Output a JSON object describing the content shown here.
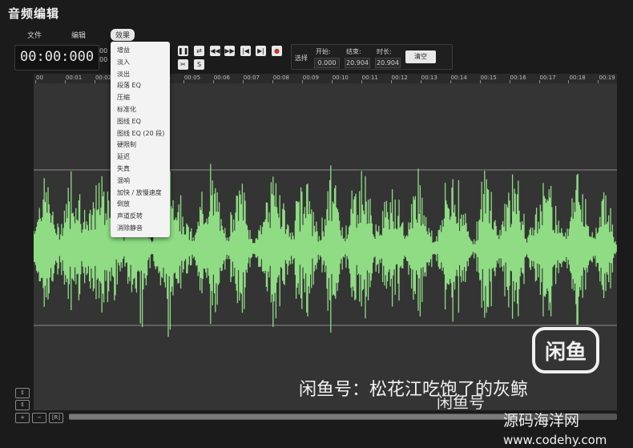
{
  "app": {
    "title": "音频编辑"
  },
  "menubar": {
    "file": "文件",
    "edit": "编辑",
    "effects": "效果"
  },
  "toolbar": {
    "time": "00:00:000",
    "time_aside": [
      "00",
      "00"
    ],
    "buttons": [
      {
        "name": "pause-button",
        "icon": "pause-icon",
        "glyph": "❚❚"
      },
      {
        "name": "loop-button",
        "icon": "loop-icon",
        "glyph": "⇄"
      },
      {
        "name": "rewind-button",
        "icon": "rewind-icon",
        "glyph": "◀◀"
      },
      {
        "name": "fast-forward-button",
        "icon": "fast-forward-icon",
        "glyph": "▶▶"
      },
      {
        "name": "skip-start-button",
        "icon": "skip-start-icon",
        "glyph": "|◀"
      },
      {
        "name": "skip-end-button",
        "icon": "skip-end-icon",
        "glyph": "▶|"
      },
      {
        "name": "record-button",
        "icon": "record-icon",
        "glyph": "●"
      },
      {
        "name": "cut-button",
        "icon": "scissors-icon",
        "glyph": "✂"
      },
      {
        "name": "split-button",
        "icon": "split-icon",
        "glyph": "S"
      }
    ]
  },
  "selection": {
    "label": "选择",
    "start_label": "开始:",
    "start_value": "0.000",
    "end_label": "结束:",
    "end_value": "20.904",
    "duration_label": "时长:",
    "duration_value": "20.904",
    "clear_label": "清空"
  },
  "ruler": {
    "ticks": [
      "00",
      "00:01",
      "00:02",
      "00:03",
      "00:04",
      "00:05",
      "00:06",
      "00:07",
      "00:08",
      "00:09",
      "00:10",
      "00:11",
      "00:12",
      "00:13",
      "00:14",
      "00:15",
      "00:16",
      "00:17",
      "00:18",
      "00:19"
    ]
  },
  "effects_menu": {
    "items": [
      "增益",
      "淡入",
      "淡出",
      "段落 EQ",
      "压缩",
      "标准化",
      "图线 EQ",
      "图线 EQ (20 段)",
      "硬限制",
      "延迟",
      "失真",
      "混响",
      "加快 / 放慢速度",
      "倒放",
      "声道反转",
      "消除静音"
    ]
  },
  "side_controls": [
    "↕",
    "↕",
    "+",
    "−",
    "[R]"
  ],
  "colors": {
    "waveform": "#8fdc84",
    "waveform_bg": "#343434",
    "page_bg": "#1b1b1b"
  },
  "watermark": {
    "logo_text": "闲鱼",
    "line1": "闲鱼号：松花江吃饱了的灰鲸",
    "line2": "闲鱼号",
    "line3": "源码海洋网",
    "line4": "www.codehy.com"
  }
}
